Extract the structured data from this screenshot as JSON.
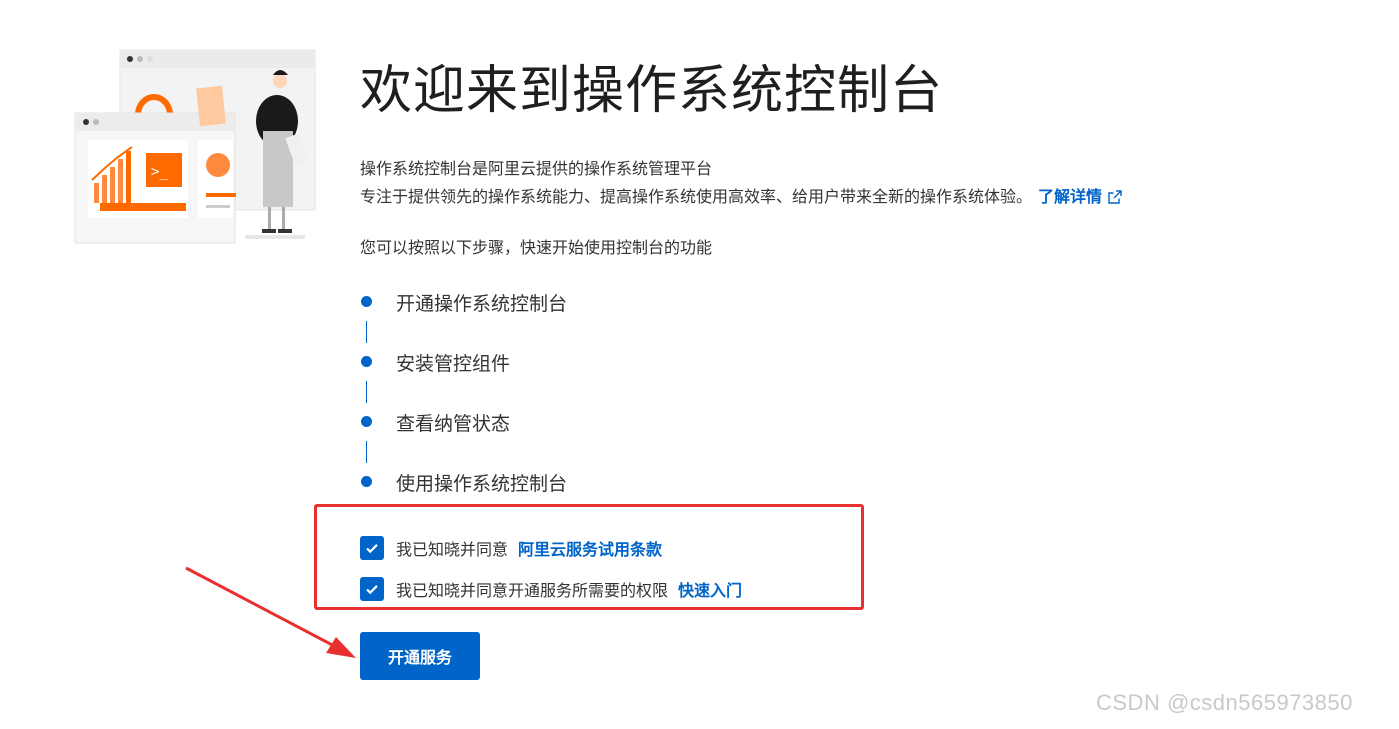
{
  "page": {
    "title": "欢迎来到操作系统控制台",
    "intro_line1": "操作系统控制台是阿里云提供的操作系统管理平台",
    "intro_line2": "专注于提供领先的操作系统能力、提高操作系统使用高效率、给用户带来全新的操作系统体验。",
    "learn_more": "了解详情",
    "steps_intro": "您可以按照以下步骤，快速开始使用控制台的功能"
  },
  "steps": [
    {
      "label": "开通操作系统控制台"
    },
    {
      "label": "安装管控组件"
    },
    {
      "label": "查看纳管状态"
    },
    {
      "label": "使用操作系统控制台"
    }
  ],
  "agreements": [
    {
      "text": "我已知晓并同意",
      "link": "阿里云服务试用条款",
      "checked": true
    },
    {
      "text": "我已知晓并同意开通服务所需要的权限",
      "link": "快速入门",
      "checked": true
    }
  ],
  "button": {
    "label": "开通服务"
  },
  "watermark": "CSDN @csdn565973850",
  "colors": {
    "primary": "#0064c8",
    "highlight_border": "#e8312f",
    "illustration_accent": "#ff6a00"
  },
  "icons": {
    "external_link": "external-link-icon",
    "checkmark": "checkmark-icon"
  }
}
